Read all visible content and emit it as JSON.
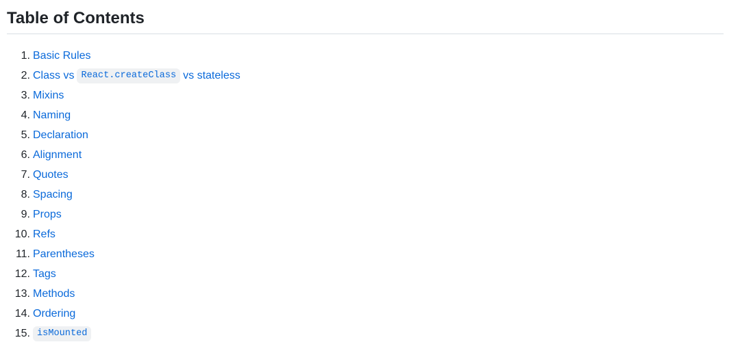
{
  "heading": "Table of Contents",
  "items": [
    {
      "number": "1",
      "label": "Basic Rules"
    },
    {
      "number": "2",
      "label_before": "Class vs",
      "code": "React.createClass",
      "label_after": "vs stateless"
    },
    {
      "number": "3",
      "label": "Mixins"
    },
    {
      "number": "4",
      "label": "Naming"
    },
    {
      "number": "5",
      "label": "Declaration"
    },
    {
      "number": "6",
      "label": "Alignment"
    },
    {
      "number": "7",
      "label": "Quotes"
    },
    {
      "number": "8",
      "label": "Spacing"
    },
    {
      "number": "9",
      "label": "Props"
    },
    {
      "number": "10",
      "label": "Refs"
    },
    {
      "number": "11",
      "label": "Parentheses"
    },
    {
      "number": "12",
      "label": "Tags"
    },
    {
      "number": "13",
      "label": "Methods"
    },
    {
      "number": "14",
      "label": "Ordering"
    },
    {
      "number": "15",
      "code": "isMounted"
    }
  ],
  "colors": {
    "link": "#0969da",
    "text": "#1f2328",
    "code_background": "#eff1f3",
    "divider": "#d8dee4"
  }
}
